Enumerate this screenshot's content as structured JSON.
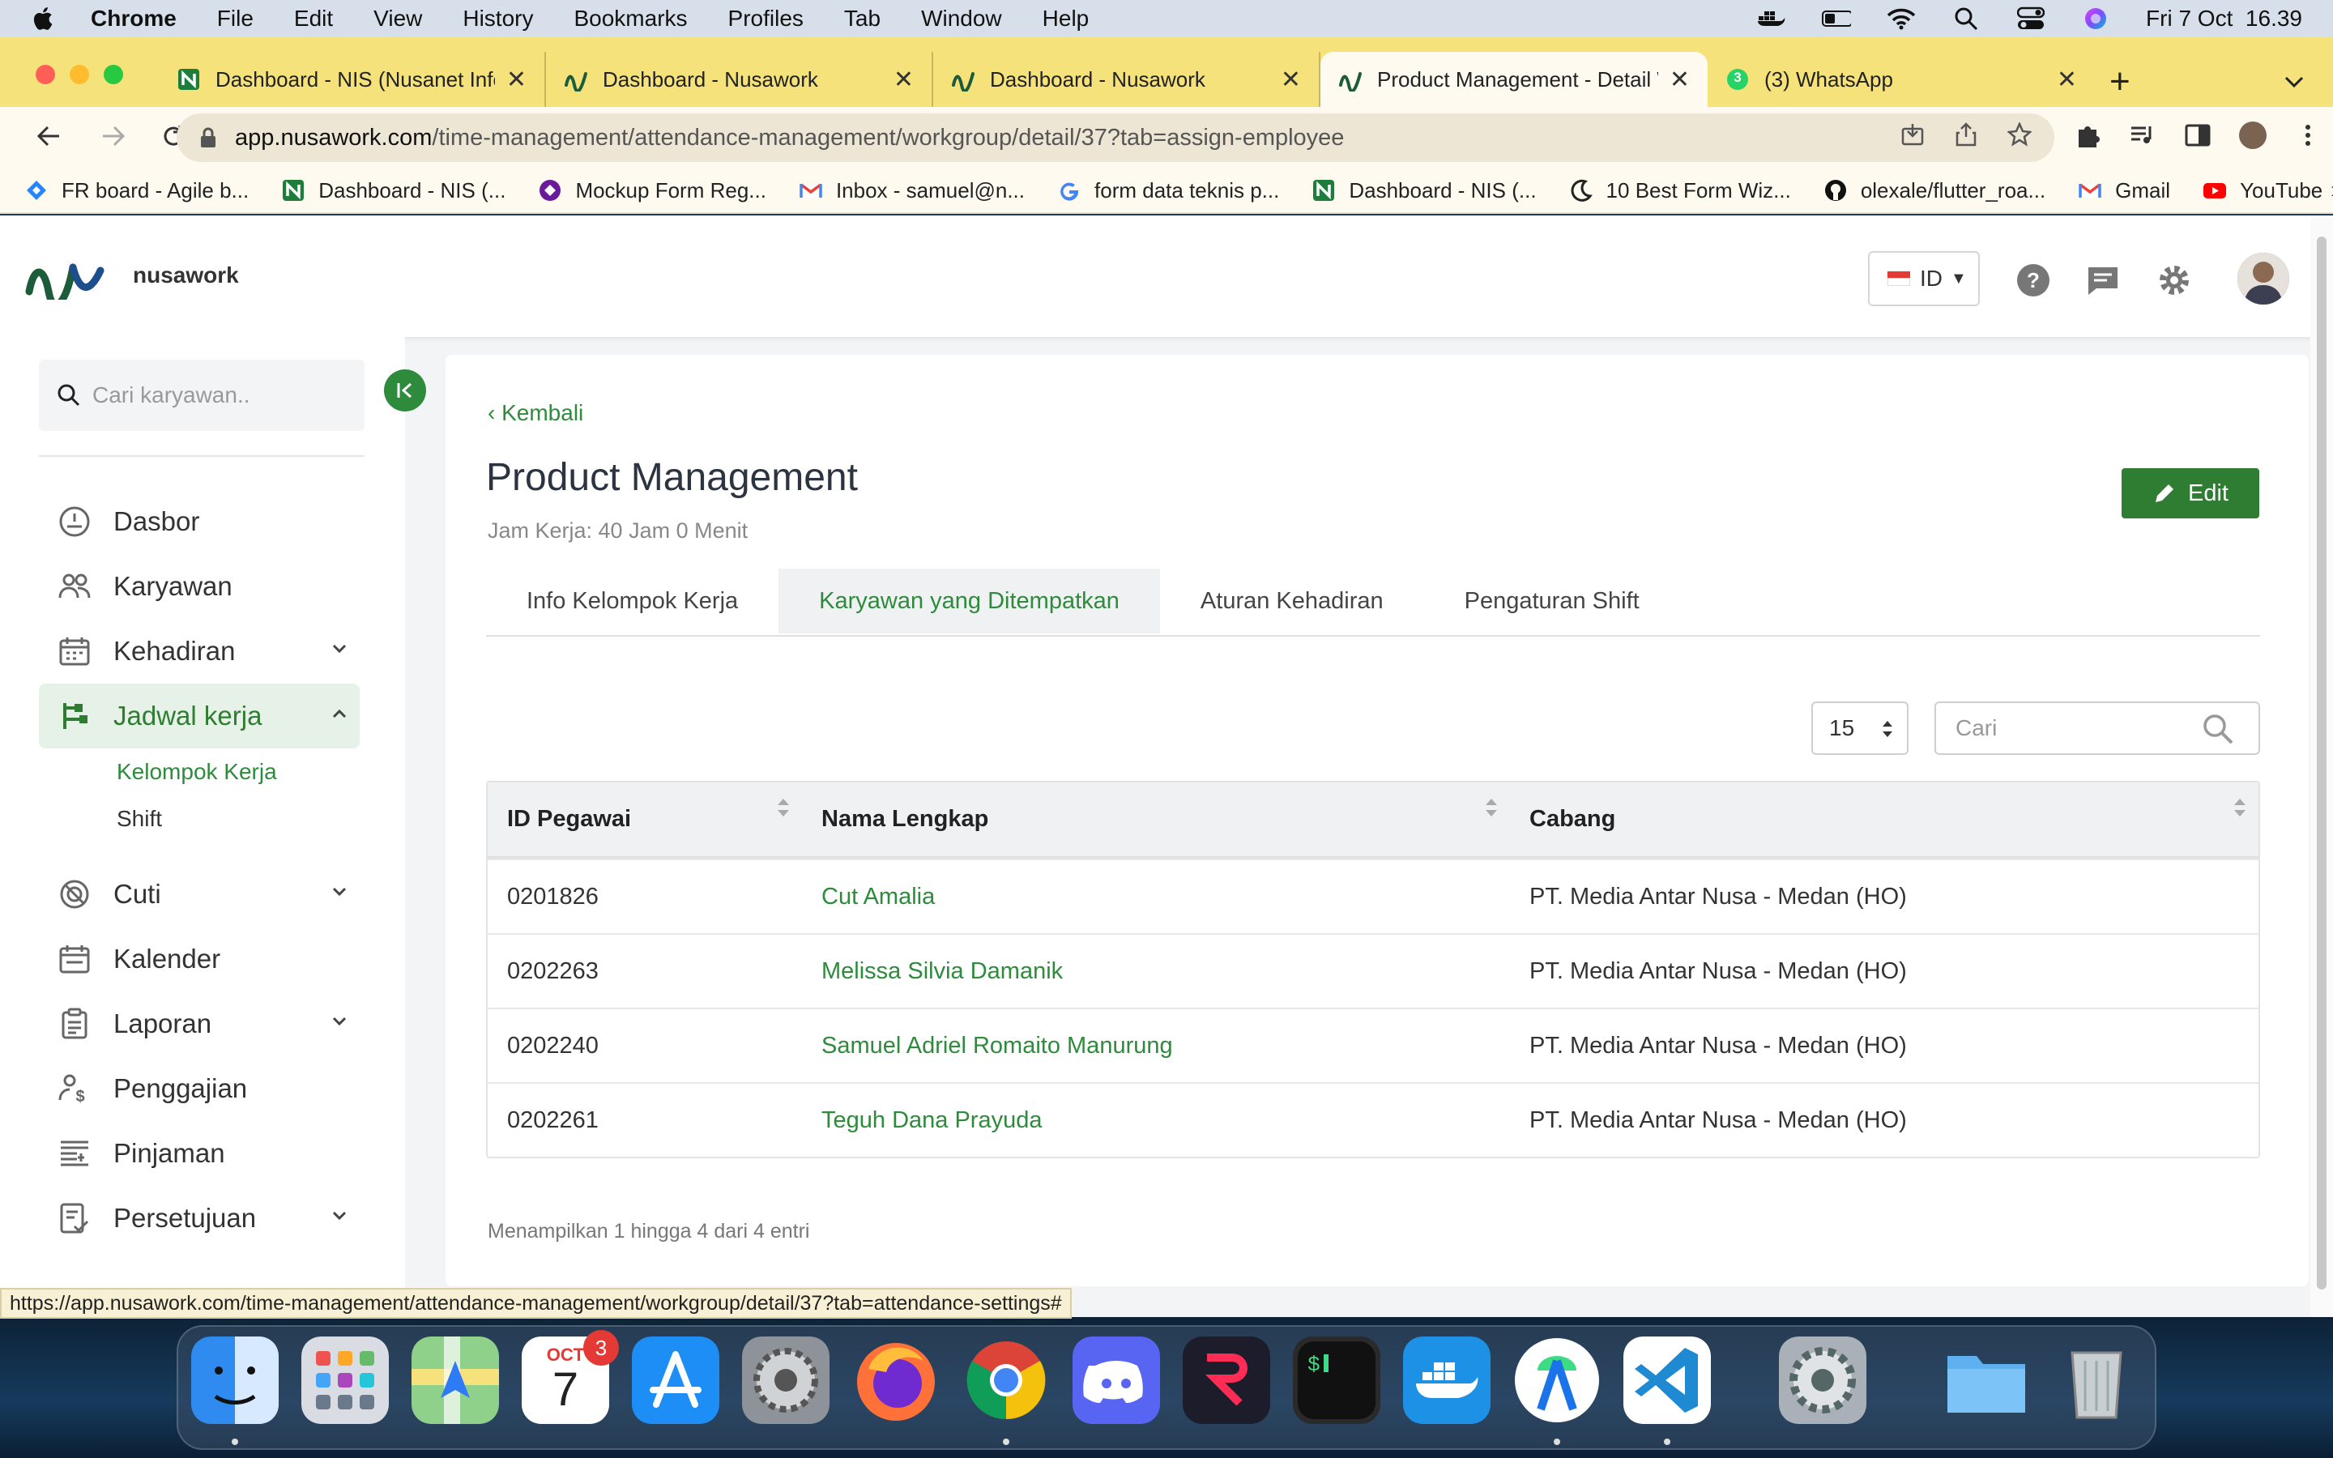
{
  "menubar": {
    "app": "Chrome",
    "items": [
      "File",
      "Edit",
      "View",
      "History",
      "Bookmarks",
      "Profiles",
      "Tab",
      "Window",
      "Help"
    ],
    "datetime": "Fri 7 Oct  16.39"
  },
  "browser": {
    "tabs": [
      {
        "title": "Dashboard - NIS (Nusanet Infor"
      },
      {
        "title": "Dashboard - Nusawork"
      },
      {
        "title": "Dashboard - Nusawork"
      },
      {
        "title": "Product Management - Detail W"
      },
      {
        "title": "(3) WhatsApp"
      }
    ],
    "whatsapp_badge": "3",
    "url_domain": "app.nusawork.com",
    "url_path": "/time-management/attendance-management/workgroup/detail/37?tab=assign-employee",
    "bookmarks": [
      "FR board - Agile b...",
      "Dashboard - NIS (...",
      "Mockup Form Reg...",
      "Inbox - samuel@n...",
      "form data teknis p...",
      "Dashboard - NIS (...",
      "10 Best Form Wiz...",
      "olexale/flutter_roa...",
      "Gmail",
      "YouTube"
    ],
    "status_url": "https://app.nusawork.com/time-management/attendance-management/workgroup/detail/37?tab=attendance-settings#"
  },
  "app": {
    "brand": "nusawork",
    "language": "ID",
    "sidebar": {
      "search_placeholder": "Cari karyawan..",
      "items": [
        {
          "label": "Dasbor"
        },
        {
          "label": "Karyawan"
        },
        {
          "label": "Kehadiran"
        },
        {
          "label": "Jadwal kerja"
        },
        {
          "label": "Cuti"
        },
        {
          "label": "Kalender"
        },
        {
          "label": "Laporan"
        },
        {
          "label": "Penggajian"
        },
        {
          "label": "Pinjaman"
        },
        {
          "label": "Persetujuan"
        }
      ],
      "subitems": [
        "Kelompok Kerja",
        "Shift"
      ]
    },
    "content": {
      "back": "Kembali",
      "title": "Product Management",
      "subtitle": "Jam Kerja: 40 Jam 0 Menit",
      "edit": "Edit",
      "tabs": [
        "Info Kelompok Kerja",
        "Karyawan yang Ditempatkan",
        "Aturan Kehadiran",
        "Pengaturan Shift"
      ],
      "per_page": "15",
      "search_placeholder": "Cari",
      "table": {
        "headers": [
          "ID Pegawai",
          "Nama Lengkap",
          "Cabang"
        ],
        "rows": [
          [
            "0201826",
            "Cut Amalia",
            "PT. Media Antar Nusa - Medan (HO)"
          ],
          [
            "0202263",
            "Melissa Silvia Damanik",
            "PT. Media Antar Nusa - Medan (HO)"
          ],
          [
            "0202240",
            "Samuel Adriel Romaito Manurung",
            "PT. Media Antar Nusa - Medan (HO)"
          ],
          [
            "0202261",
            "Teguh Dana Prayuda",
            "PT. Media Antar Nusa - Medan (HO)"
          ]
        ]
      },
      "entries": "Menampilkan 1 hingga 4 dari 4 entri"
    }
  },
  "dock": {
    "calendar_month": "OCT",
    "calendar_day": "7",
    "calendar_badge": "3"
  },
  "colors": {
    "accent": "#2e8b3c",
    "chrome_tabstrip": "#f5e27a"
  }
}
